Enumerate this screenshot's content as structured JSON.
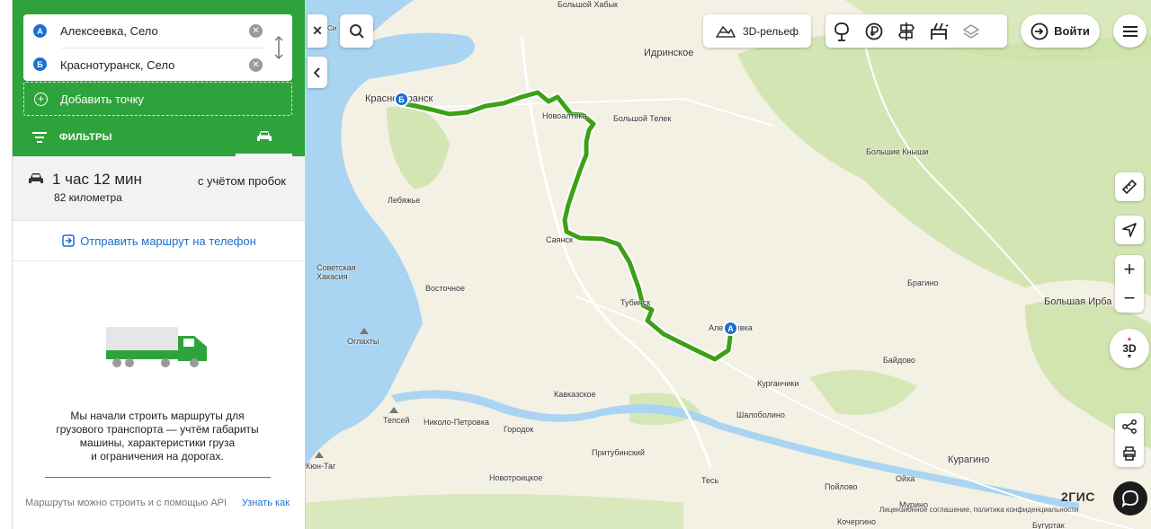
{
  "route": {
    "point_a_marker": "A",
    "point_a": "Алексеевка, Село",
    "point_b_marker": "Б",
    "point_b": "Краснотуранск, Село",
    "add_point": "Добавить точку",
    "filters_label": "ФИЛЬТРЫ"
  },
  "summary": {
    "duration": "1 час 12 мин",
    "traffic_note": "с учётом пробок",
    "distance": "82 километра"
  },
  "send_phone": "Отправить маршрут на телефон",
  "promo": {
    "line1": "Мы начали строить маршруты для",
    "line2": "грузового транспорта — учтём габариты",
    "line3": "машины, характеристики груза",
    "line4": "и ограничения на дорогах.",
    "api_note": "Маршруты можно строить и с помощью API",
    "learn_more": "Узнать как"
  },
  "toolbar": {
    "relief": "3D-рельеф",
    "login": "Войти",
    "zoom_in": "+",
    "zoom_out": "−",
    "view_3d": "3D"
  },
  "map": {
    "search_text": "Си",
    "places": [
      {
        "name": "Большой Хабык"
      },
      {
        "name": "Идринское"
      },
      {
        "name": "Большой Телек"
      },
      {
        "name": "Большие Кныши"
      },
      {
        "name": "Краснотуранск"
      },
      {
        "name": "Новоалтвка"
      },
      {
        "name": "Лебяжье"
      },
      {
        "name": "Саянск"
      },
      {
        "name": "Советская Хакасия"
      },
      {
        "name": "Восточное"
      },
      {
        "name": "Тубинск"
      },
      {
        "name": "Алексеевка"
      },
      {
        "name": "Брагино"
      },
      {
        "name": "Большая Ирба"
      },
      {
        "name": "Оглахты"
      },
      {
        "name": "Байдово"
      },
      {
        "name": "Курганчики"
      },
      {
        "name": "Кавказское"
      },
      {
        "name": "Шалоболино"
      },
      {
        "name": "Тепсей"
      },
      {
        "name": "Николо-Петровка"
      },
      {
        "name": "Городок"
      },
      {
        "name": "Притубинский"
      },
      {
        "name": "Кюн-Таг"
      },
      {
        "name": "Новотроицкое"
      },
      {
        "name": "Тесь"
      },
      {
        "name": "Пойлово"
      },
      {
        "name": "Ойха"
      },
      {
        "name": "Курагино"
      },
      {
        "name": "Мурино"
      },
      {
        "name": "Кочергино"
      },
      {
        "name": "Бугуртак"
      }
    ],
    "logo": "2ГИС",
    "license": "Лицензионное соглашение, политика конфиденциальности"
  },
  "colors": {
    "brand_green": "#2fa33b",
    "route_green": "#3da017",
    "pin_blue": "#1a6fd1",
    "water": "#a9d4f2",
    "forest": "#c9e2a4"
  }
}
